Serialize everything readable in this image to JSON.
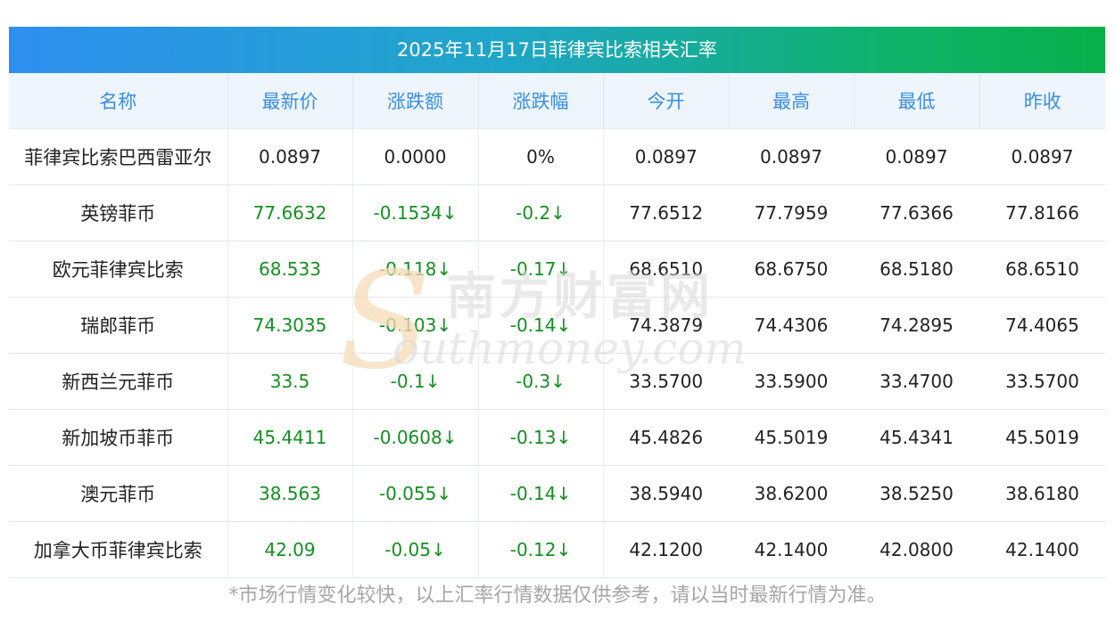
{
  "title": "2025年11月17日菲律宾比索相关汇率",
  "headers": [
    "名称",
    "最新价",
    "涨跌额",
    "涨跌幅",
    "今开",
    "最高",
    "最低",
    "昨收"
  ],
  "rows": [
    {
      "name": "菲律宾比索巴西雷亚尔",
      "latest": "0.0897",
      "change": "0.0000",
      "pct": "0%",
      "open": "0.0897",
      "high": "0.0897",
      "low": "0.0897",
      "prev_close": "0.0897",
      "trend": "flat"
    },
    {
      "name": "英镑菲币",
      "latest": "77.6632",
      "change": "-0.1534↓",
      "pct": "-0.2↓",
      "open": "77.6512",
      "high": "77.7959",
      "low": "77.6366",
      "prev_close": "77.8166",
      "trend": "down"
    },
    {
      "name": "欧元菲律宾比索",
      "latest": "68.533",
      "change": "-0.118↓",
      "pct": "-0.17↓",
      "open": "68.6510",
      "high": "68.6750",
      "low": "68.5180",
      "prev_close": "68.6510",
      "trend": "down"
    },
    {
      "name": "瑞郎菲币",
      "latest": "74.3035",
      "change": "-0.103↓",
      "pct": "-0.14↓",
      "open": "74.3879",
      "high": "74.4306",
      "low": "74.2895",
      "prev_close": "74.4065",
      "trend": "down"
    },
    {
      "name": "新西兰元菲币",
      "latest": "33.5",
      "change": "-0.1↓",
      "pct": "-0.3↓",
      "open": "33.5700",
      "high": "33.5900",
      "low": "33.4700",
      "prev_close": "33.5700",
      "trend": "down"
    },
    {
      "name": "新加坡币菲币",
      "latest": "45.4411",
      "change": "-0.0608↓",
      "pct": "-0.13↓",
      "open": "45.4826",
      "high": "45.5019",
      "low": "45.4341",
      "prev_close": "45.5019",
      "trend": "down"
    },
    {
      "name": "澳元菲币",
      "latest": "38.563",
      "change": "-0.055↓",
      "pct": "-0.14↓",
      "open": "38.5940",
      "high": "38.6200",
      "low": "38.5250",
      "prev_close": "38.6180",
      "trend": "down"
    },
    {
      "name": "加拿大币菲律宾比索",
      "latest": "42.09",
      "change": "-0.05↓",
      "pct": "-0.12↓",
      "open": "42.1200",
      "high": "42.1400",
      "low": "42.0800",
      "prev_close": "42.1400",
      "trend": "down"
    }
  ],
  "watermark": {
    "cn": "南方财富网",
    "en": "outhmoney.com",
    "letter": "S"
  },
  "note": "*市场行情变化较快，以上汇率行情数据仅供参考，请以当时最新行情为准。",
  "colors": {
    "down": "#139020",
    "header_text": "#3a8ee6",
    "title_start": "#2f8ff0",
    "title_end": "#08b04a"
  }
}
